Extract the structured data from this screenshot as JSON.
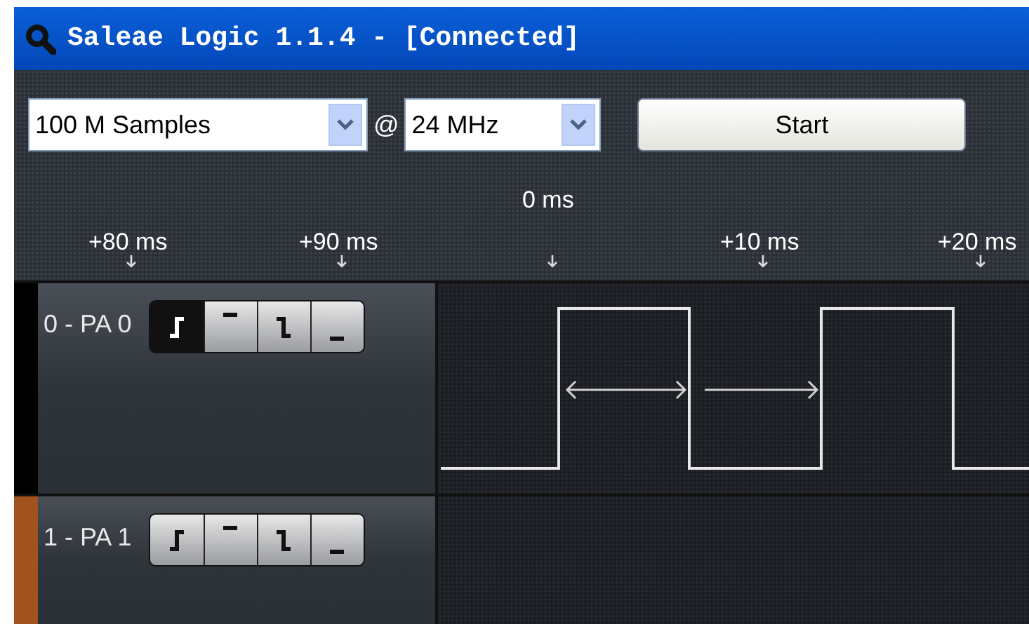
{
  "window": {
    "title": "Saleae Logic 1.1.4 - [Connected]"
  },
  "toolbar": {
    "samples": {
      "value": "100 M Samples"
    },
    "at": "@",
    "rate": {
      "value": "24 MHz"
    },
    "start_button": "Start"
  },
  "ruler": {
    "center": "0 ms",
    "ticks": [
      "+80 ms",
      "+90 ms",
      "+10 ms",
      "+20 ms"
    ]
  },
  "channels": [
    {
      "name": "0 - PA 0",
      "color": "#000000",
      "waveform": true,
      "triggers": [
        {
          "kind": "rising",
          "selected": true
        },
        {
          "kind": "high",
          "selected": false
        },
        {
          "kind": "falling",
          "selected": false
        },
        {
          "kind": "low",
          "selected": false
        }
      ]
    },
    {
      "name": "1 - PA 1",
      "color": "#a0531c",
      "waveform": false,
      "triggers": [
        {
          "kind": "rising",
          "selected": false
        },
        {
          "kind": "high",
          "selected": false
        },
        {
          "kind": "falling",
          "selected": false
        },
        {
          "kind": "low",
          "selected": false
        }
      ]
    }
  ]
}
